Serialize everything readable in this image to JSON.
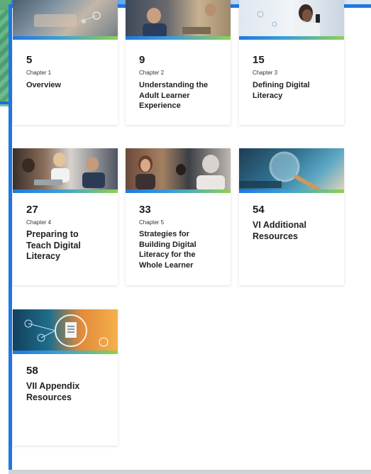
{
  "cards": [
    {
      "page": "5",
      "chapter": "Chapter 1",
      "title": "Overview"
    },
    {
      "page": "9",
      "chapter": "Chapter 2",
      "title": "Understanding the Adult Learner Experience"
    },
    {
      "page": "15",
      "chapter": "Chapter 3",
      "title": "Defining Digital Literacy"
    },
    {
      "page": "27",
      "chapter": "Chapter 4",
      "title": "Preparing to Teach Digital Literacy"
    },
    {
      "page": "33",
      "chapter": "Chapter 5",
      "title": "Strategies for Building Digital Literacy for the Whole Learner"
    },
    {
      "page": "54",
      "title": "VI Additional Resources"
    },
    {
      "page": "58",
      "title": "VII Appendix Resources"
    }
  ],
  "colors": {
    "accent": "#1f78e0",
    "gradient_end": "#8fd14f"
  },
  "images": [
    "laptop-hands-photo",
    "meeting-photo",
    "woman-phone-photo",
    "group-laptop-photo",
    "conversation-photo",
    "magnifier-keyboard-photo",
    "digital-network-illustration"
  ]
}
